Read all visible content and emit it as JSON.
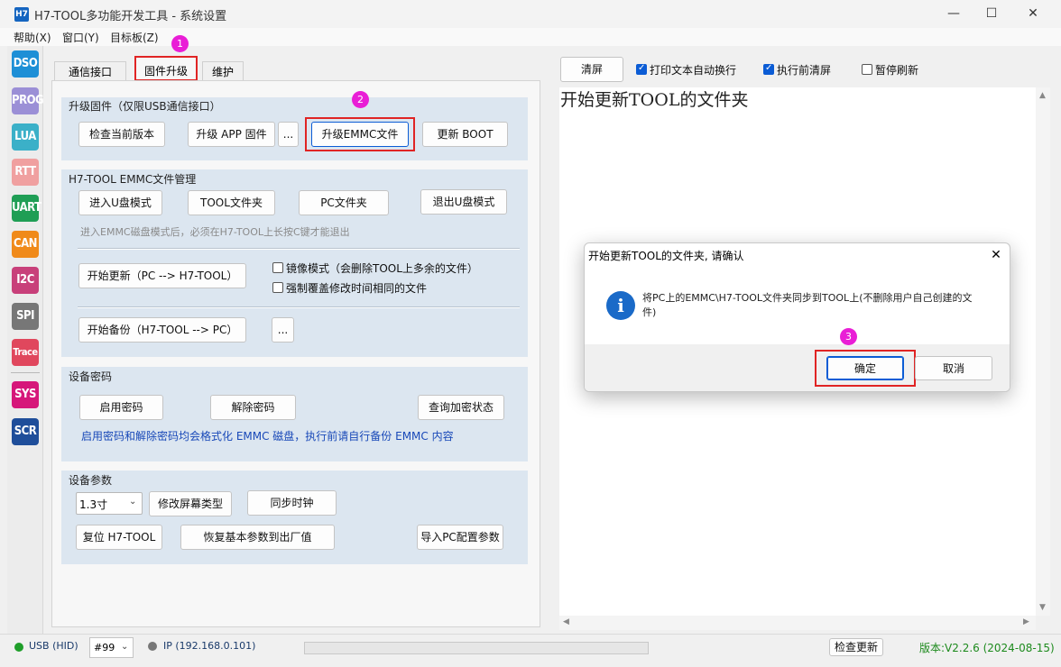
{
  "window": {
    "title": "H7-TOOL多功能开发工具 - 系统设置",
    "app_icon": "H7",
    "minimize": "—",
    "maximize": "☐",
    "close": "✕"
  },
  "menu": [
    "帮助(X)",
    "窗口(Y)",
    "目标板(Z)"
  ],
  "sidebar": [
    {
      "label": "DSO",
      "color": "#1e8fd6"
    },
    {
      "label": "PROG",
      "color": "#9b8fd6"
    },
    {
      "label": "LUA",
      "color": "#3bb0c8"
    },
    {
      "label": "RTT",
      "color": "#f0a0a0"
    },
    {
      "label": "UART",
      "color": "#1f9e55"
    },
    {
      "label": "CAN",
      "color": "#f08a1a"
    },
    {
      "label": "I2C",
      "color": "#c8407a"
    },
    {
      "label": "SPI",
      "color": "#777777"
    },
    {
      "label": "Trace",
      "color": "#e0475d"
    },
    {
      "label": "SYS",
      "color": "#d6177a"
    },
    {
      "label": "SCR",
      "color": "#1f4e9a"
    }
  ],
  "tabs": [
    "通信接口",
    "固件升级",
    "维护"
  ],
  "upgrade": {
    "title": "升级固件（仅限USB通信接口）",
    "check_version": "检查当前版本",
    "upgrade_app": "升级 APP 固件",
    "more": "...",
    "upgrade_emmc": "升级EMMC文件",
    "update_boot": "更新 BOOT"
  },
  "emmc": {
    "title": "H7-TOOL EMMC文件管理",
    "enter_udisk": "进入U盘模式",
    "tool_folder": "TOOL文件夹",
    "pc_folder": "PC文件夹",
    "exit_udisk": "退出U盘模式",
    "hint": "进入EMMC磁盘模式后，必须在H7-TOOL上长按C键才能退出",
    "start_update": "开始更新（PC --> H7-TOOL）",
    "mirror_mode": "镜像模式（会删除TOOL上多余的文件）",
    "force_overwrite": "强制覆盖修改时间相同的文件",
    "start_backup": "开始备份（H7-TOOL --> PC）",
    "more": "..."
  },
  "password": {
    "title": "设备密码",
    "enable": "启用密码",
    "disable": "解除密码",
    "query": "查询加密状态",
    "note": "启用密码和解除密码均会格式化 EMMC 磁盘，执行前请自行备份 EMMC 内容"
  },
  "params": {
    "title": "设备参数",
    "screen_size": "1.3寸",
    "modify_screen": "修改屏幕类型",
    "sync_clock": "同步时钟",
    "reset": "复位 H7-TOOL",
    "restore": "恢复基本参数到出厂值",
    "import": "导入PC配置参数"
  },
  "log_toolbar": {
    "clear": "清屏",
    "wrap": "打印文本自动换行",
    "wrap_checked": true,
    "clear_before": "执行前清屏",
    "clear_before_checked": true,
    "pause": "暂停刷新",
    "pause_checked": false
  },
  "log": {
    "text": "开始更新TOOL的文件夹"
  },
  "dialog": {
    "title": "开始更新TOOL的文件夹, 请确认",
    "message": "将PC上的EMMC\\H7-TOOL文件夹同步到TOOL上(不删除用户自己创建的文件)",
    "ok": "确定",
    "cancel": "取消",
    "close": "✕",
    "icon": "i"
  },
  "markers": [
    "1",
    "2",
    "3"
  ],
  "status": {
    "usb": "USB (HID)",
    "usb_color": "#1f9e2a",
    "device_no": "#99",
    "ip": "IP (192.168.0.101)",
    "ip_color": "#777777",
    "check_update": "检查更新",
    "version": "版本:V2.2.6 (2024-08-15)",
    "version_color": "#1d8a1d"
  },
  "accent": {
    "highlight": "#e02424",
    "marker": "#e91ed6"
  }
}
